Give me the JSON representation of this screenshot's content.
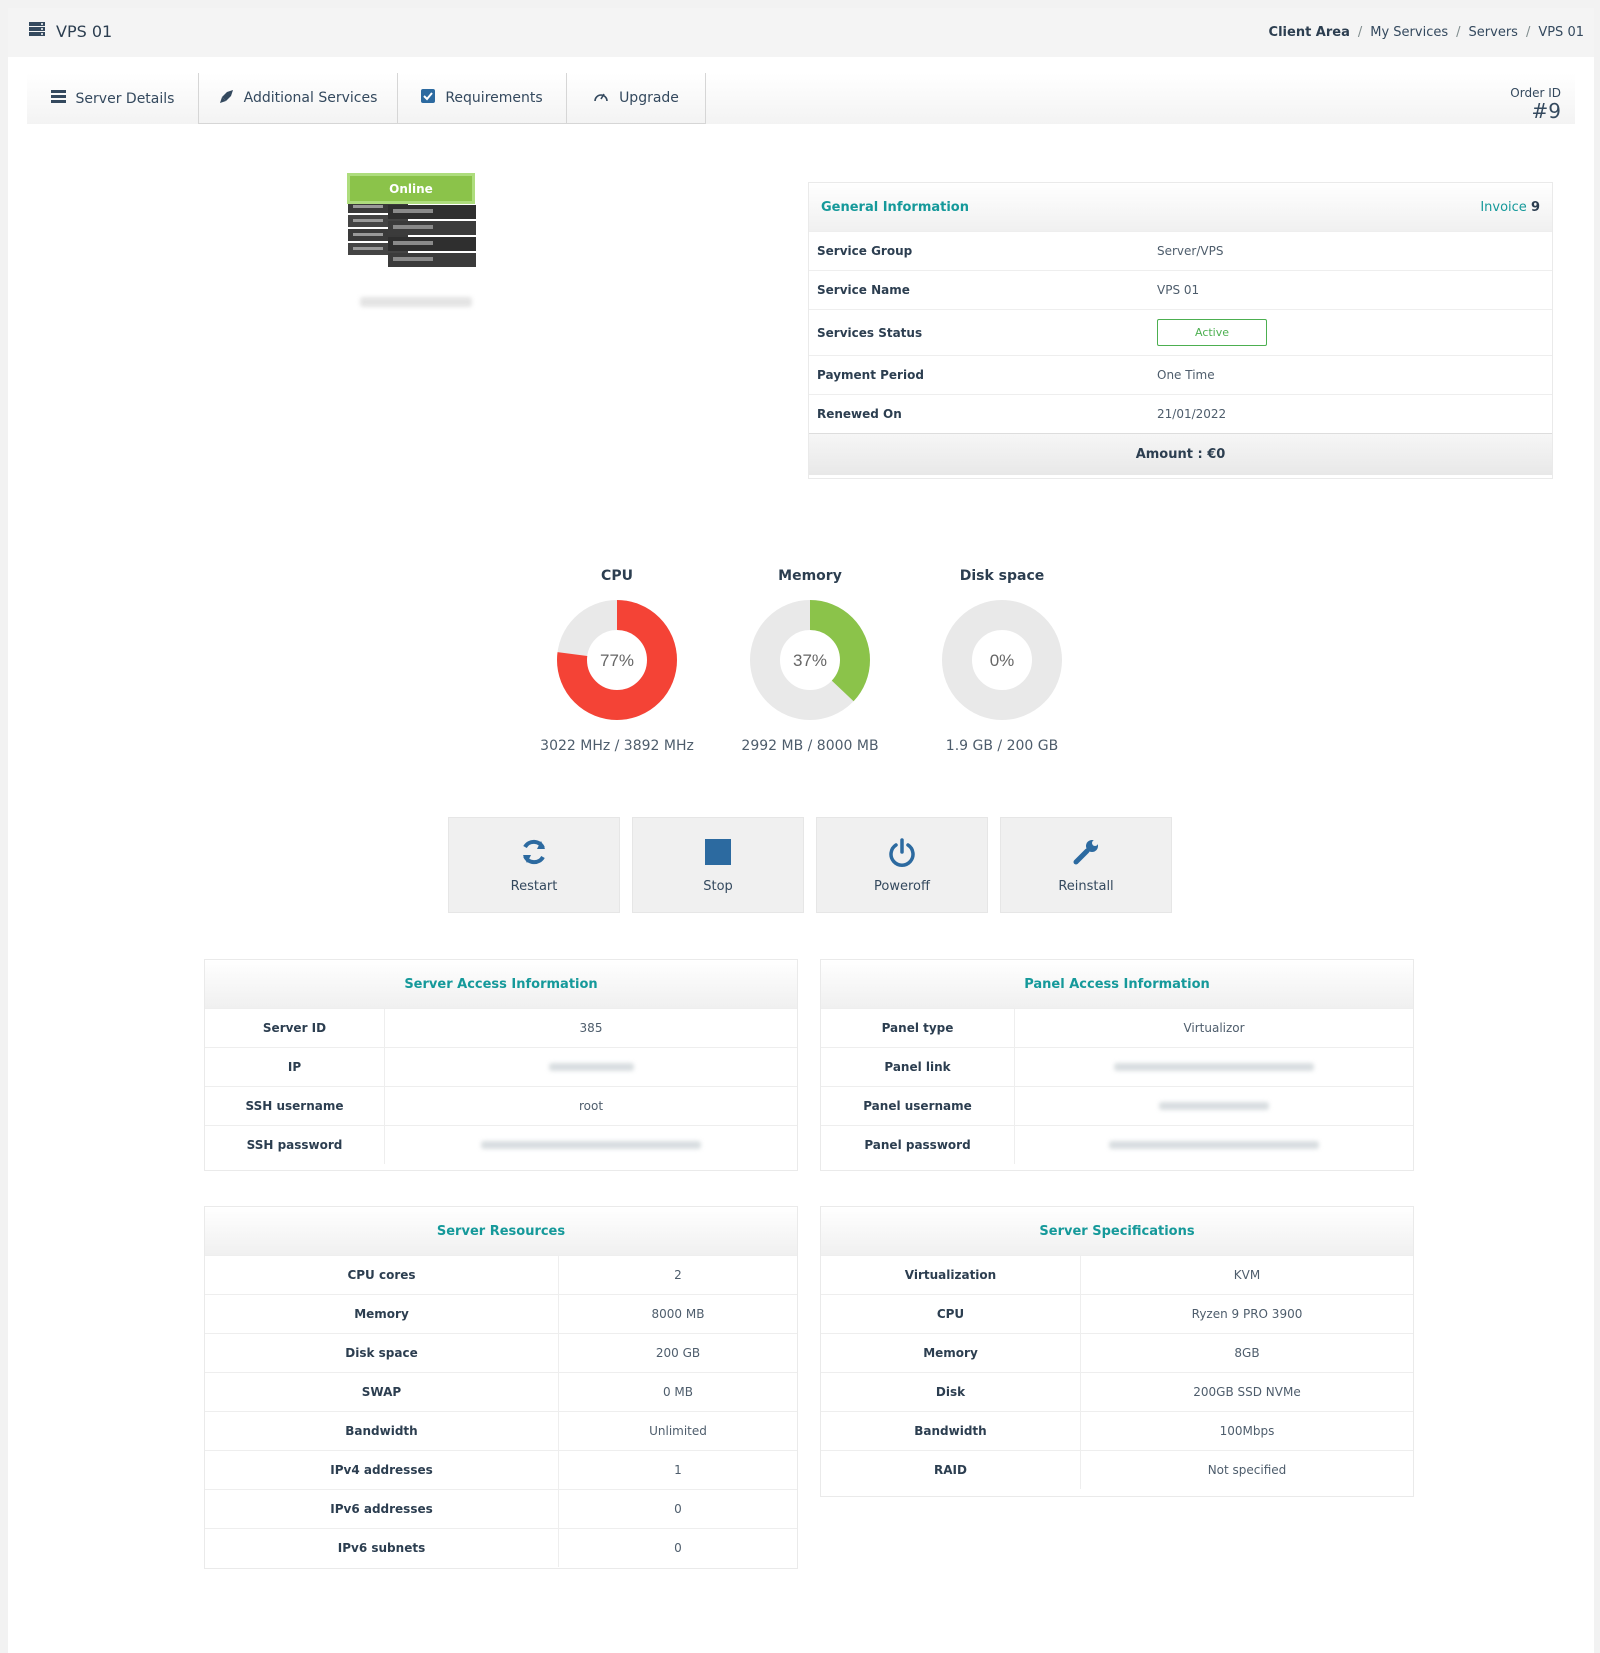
{
  "header": {
    "title": "VPS 01",
    "breadcrumb": [
      "Client Area",
      "My Services",
      "Servers",
      "VPS 01"
    ],
    "breadcrumb_separator": "/"
  },
  "tabs": [
    {
      "label": "Server Details",
      "icon": "server-icon"
    },
    {
      "label": "Additional Services",
      "icon": "rocket-icon"
    },
    {
      "label": "Requirements",
      "icon": "checkbox-icon"
    },
    {
      "label": "Upgrade",
      "icon": "gauge-icon"
    }
  ],
  "order": {
    "label": "Order ID",
    "value": "#9"
  },
  "status": {
    "label": "Online",
    "color": "#8bc34a"
  },
  "general": {
    "title": "General Information",
    "invoice_label": "Invoice",
    "invoice_number": "9",
    "rows": [
      {
        "key": "Service Group",
        "value": "Server/VPS"
      },
      {
        "key": "Service Name",
        "value": "VPS 01"
      },
      {
        "key": "Services Status",
        "value": "Active"
      },
      {
        "key": "Payment Period",
        "value": "One Time"
      },
      {
        "key": "Renewed On",
        "value": "21/01/2022"
      }
    ],
    "amount": "Amount : €0"
  },
  "gauges": [
    {
      "title": "CPU",
      "percent": 77,
      "label": "77%",
      "detail": "3022 MHz / 3892 MHz",
      "color": "#f44336"
    },
    {
      "title": "Memory",
      "percent": 37,
      "label": "37%",
      "detail": "2992 MB / 8000 MB",
      "color": "#8bc34a"
    },
    {
      "title": "Disk space",
      "percent": 0,
      "label": "0%",
      "detail": "1.9 GB / 200 GB",
      "color": "#8bc34a"
    }
  ],
  "actions": [
    {
      "label": "Restart",
      "icon": "refresh-icon"
    },
    {
      "label": "Stop",
      "icon": "stop-icon"
    },
    {
      "label": "Poweroff",
      "icon": "power-icon"
    },
    {
      "label": "Reinstall",
      "icon": "wrench-icon"
    }
  ],
  "server_access": {
    "title": "Server Access Information",
    "rows": [
      {
        "key": "Server ID",
        "value": "385"
      },
      {
        "key": "IP",
        "value": ""
      },
      {
        "key": "SSH username",
        "value": "root"
      },
      {
        "key": "SSH password",
        "value": ""
      }
    ]
  },
  "panel_access": {
    "title": "Panel Access Information",
    "rows": [
      {
        "key": "Panel type",
        "value": "Virtualizor"
      },
      {
        "key": "Panel link",
        "value": ""
      },
      {
        "key": "Panel username",
        "value": ""
      },
      {
        "key": "Panel password",
        "value": ""
      }
    ]
  },
  "resources": {
    "title": "Server Resources",
    "rows": [
      {
        "key": "CPU cores",
        "value": "2"
      },
      {
        "key": "Memory",
        "value": "8000 MB"
      },
      {
        "key": "Disk space",
        "value": "200 GB"
      },
      {
        "key": "SWAP",
        "value": "0 MB"
      },
      {
        "key": "Bandwidth",
        "value": "Unlimited"
      },
      {
        "key": "IPv4 addresses",
        "value": "1"
      },
      {
        "key": "IPv6 addresses",
        "value": "0"
      },
      {
        "key": "IPv6 subnets",
        "value": "0"
      }
    ]
  },
  "specs": {
    "title": "Server Specifications",
    "rows": [
      {
        "key": "Virtualization",
        "value": "KVM"
      },
      {
        "key": "CPU",
        "value": "Ryzen 9 PRO 3900"
      },
      {
        "key": "Memory",
        "value": "8GB"
      },
      {
        "key": "Disk",
        "value": "200GB SSD NVMe"
      },
      {
        "key": "Bandwidth",
        "value": "100Mbps"
      },
      {
        "key": "RAID",
        "value": "Not specified"
      }
    ]
  },
  "colors": {
    "accent": "#15999a",
    "text": "#2c3e50",
    "active": "#4caf50"
  }
}
